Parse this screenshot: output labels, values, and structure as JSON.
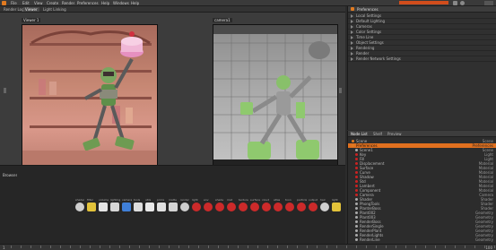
{
  "menubar": {
    "items": [
      "File",
      "Edit",
      "View",
      "Create",
      "Render",
      "Preferences",
      "Help",
      "Windows",
      "Help"
    ],
    "accent": "#d14d1c"
  },
  "viewer": {
    "tabs": [
      "Render Log",
      "Viewer",
      "Light Linking"
    ],
    "left_pane_title": "Viewer 1",
    "right_pane_title": "camera1",
    "left_footer": "Displayed layer: Beauty",
    "right_footer": "Displayed layer"
  },
  "preferences": {
    "title": "Preferences",
    "rows": [
      "Local Settings",
      "Default Lighting",
      "Cameras",
      "Color Settings",
      "Time Line",
      "Object Settings",
      "Rendering",
      "Render",
      "Render Network Settings"
    ]
  },
  "node_list": {
    "tabs": [
      "Node List",
      "Shelf",
      "Preview"
    ],
    "rows": [
      {
        "name": "Scene",
        "type": "Scene",
        "color": "#e07a20"
      },
      {
        "name": "Preferences",
        "type": "Preferences",
        "color": "#e07a20",
        "selected": true
      },
      {
        "name": "Scene1",
        "type": "Scene",
        "color": "#aaa"
      },
      {
        "name": "Key",
        "type": "Light",
        "color": "#c22"
      },
      {
        "name": "Fill",
        "type": "Light",
        "color": "#c22"
      },
      {
        "name": "Displacement",
        "type": "Material",
        "color": "#c22"
      },
      {
        "name": "Surface",
        "type": "Material",
        "color": "#c22"
      },
      {
        "name": "Curve",
        "type": "Material",
        "color": "#c22"
      },
      {
        "name": "Shadow",
        "type": "Material",
        "color": "#c22"
      },
      {
        "name": "Std",
        "type": "Material",
        "color": "#c22"
      },
      {
        "name": "Lambert",
        "type": "Material",
        "color": "#c22"
      },
      {
        "name": "Component",
        "type": "Material",
        "color": "#c22"
      },
      {
        "name": "Camera",
        "type": "Camera",
        "color": "#c22"
      },
      {
        "name": "Shader",
        "type": "Shader",
        "color": "#aaa"
      },
      {
        "name": "PhongTools",
        "type": "Shader",
        "color": "#aaa"
      },
      {
        "name": "PlanterBoss",
        "type": "Shader",
        "color": "#aaa"
      },
      {
        "name": "Plant002",
        "type": "Geometry",
        "color": "#aaa"
      },
      {
        "name": "Plant003",
        "type": "Geometry",
        "color": "#aaa"
      },
      {
        "name": "RenderBoss",
        "type": "Geometry",
        "color": "#aaa"
      },
      {
        "name": "RenderSingle",
        "type": "Geometry",
        "color": "#aaa"
      },
      {
        "name": "RenderPlant",
        "type": "Geometry",
        "color": "#aaa"
      },
      {
        "name": "RenderLights",
        "type": "Geometry",
        "color": "#aaa"
      },
      {
        "name": "RenderLine",
        "type": "Geometry",
        "color": "#aaa"
      }
    ]
  },
  "browser": {
    "title": "Browser",
    "shelf_labels": [
      "shader",
      "filter",
      "volume",
      "lighting",
      "camera",
      "tools",
      "utils",
      "prims",
      "matte",
      "render",
      "light",
      "env",
      "shade",
      "mat",
      "texture",
      "surface",
      "cloud",
      "atlas",
      "toon",
      "particle",
      "output",
      "hair",
      "light"
    ]
  },
  "timeline": {
    "start": "1",
    "end": "100"
  }
}
